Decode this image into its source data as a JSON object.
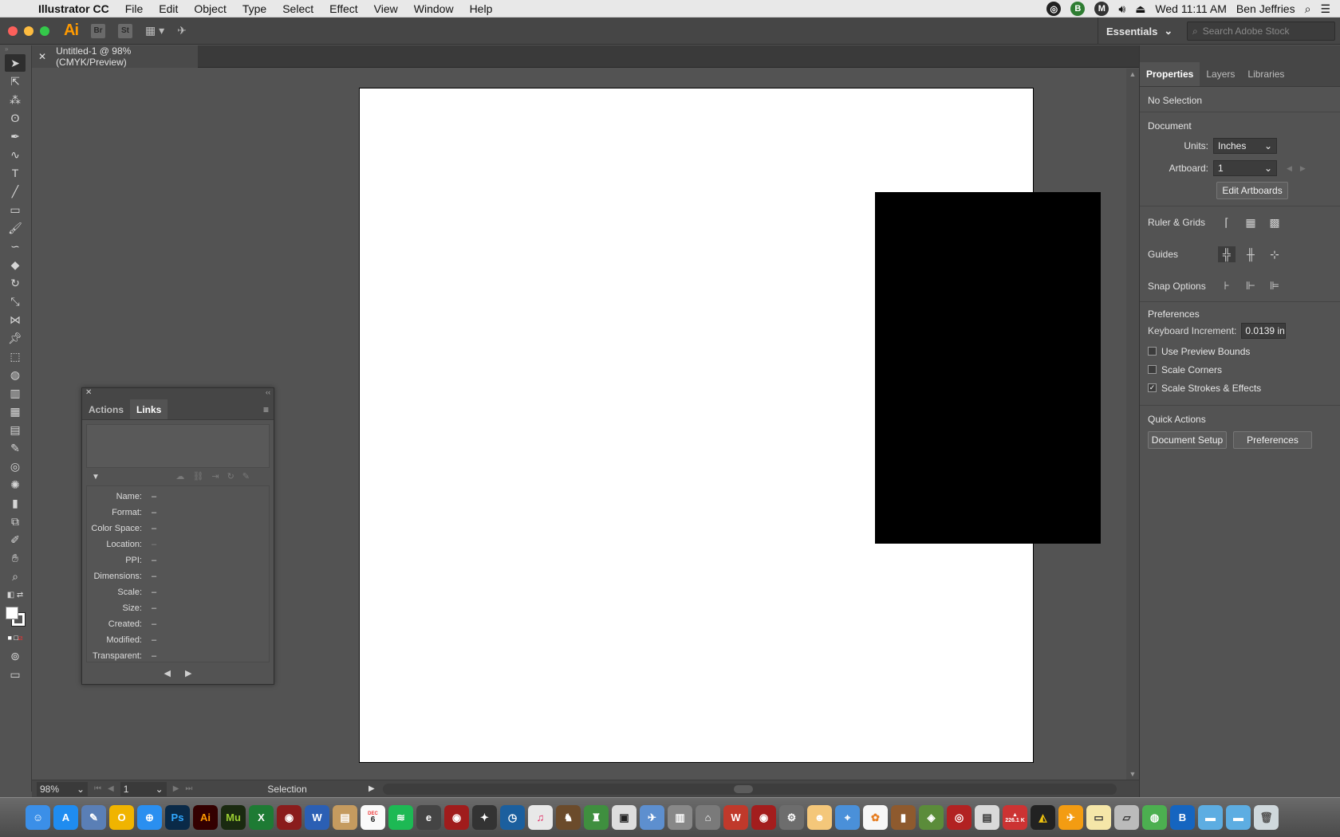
{
  "menubar": {
    "app_name": "Illustrator CC",
    "items": [
      "File",
      "Edit",
      "Object",
      "Type",
      "Select",
      "Effect",
      "View",
      "Window",
      "Help"
    ],
    "datetime": "Wed 11:11 AM",
    "user": "Ben Jeffries"
  },
  "appbar": {
    "logo": "Ai",
    "bridge_label": "Br",
    "stock_label": "St",
    "workspace": "Essentials",
    "search_placeholder": "Search Adobe Stock"
  },
  "document": {
    "tab_title": "Untitled-1 @ 98% (CMYK/Preview)"
  },
  "statusbar": {
    "zoom": "98%",
    "artboard": "1",
    "tool_name": "Selection"
  },
  "properties_panel": {
    "tabs": [
      "Properties",
      "Layers",
      "Libraries"
    ],
    "selection": "No Selection",
    "document_heading": "Document",
    "units_label": "Units:",
    "units_value": "Inches",
    "artboard_label": "Artboard:",
    "artboard_value": "1",
    "edit_artboards": "Edit Artboards",
    "rulers_label": "Ruler & Grids",
    "guides_label": "Guides",
    "snap_label": "Snap Options",
    "preferences_heading": "Preferences",
    "keyboard_increment_label": "Keyboard Increment:",
    "keyboard_increment_value": "0.0139 in",
    "checkboxes": [
      {
        "label": "Use Preview Bounds",
        "checked": false
      },
      {
        "label": "Scale Corners",
        "checked": false
      },
      {
        "label": "Scale Strokes & Effects",
        "checked": true
      }
    ],
    "quick_actions_heading": "Quick Actions",
    "document_setup": "Document Setup",
    "preferences_button": "Preferences"
  },
  "links_panel": {
    "tabs": [
      "Actions",
      "Links"
    ],
    "active_tab": "Links",
    "info": [
      {
        "key": "Name:",
        "value": "–"
      },
      {
        "key": "Format:",
        "value": "–"
      },
      {
        "key": "Color Space:",
        "value": "–"
      },
      {
        "key": "Location:",
        "value": "–"
      },
      {
        "key": "PPI:",
        "value": "–"
      },
      {
        "key": "Dimensions:",
        "value": "–"
      },
      {
        "key": "Scale:",
        "value": "–"
      },
      {
        "key": "Size:",
        "value": "–"
      },
      {
        "key": "Created:",
        "value": "–"
      },
      {
        "key": "Modified:",
        "value": "–"
      },
      {
        "key": "Transparent:",
        "value": "–"
      }
    ]
  },
  "dock": {
    "calendar_day": "6",
    "calendar_month": "DEC",
    "badge": "226.1 K"
  },
  "colors": {
    "illustrator_orange": "#ff9a00",
    "ui_dark": "#535353",
    "artboard": "#ffffff",
    "shape_fill": "#000000"
  }
}
